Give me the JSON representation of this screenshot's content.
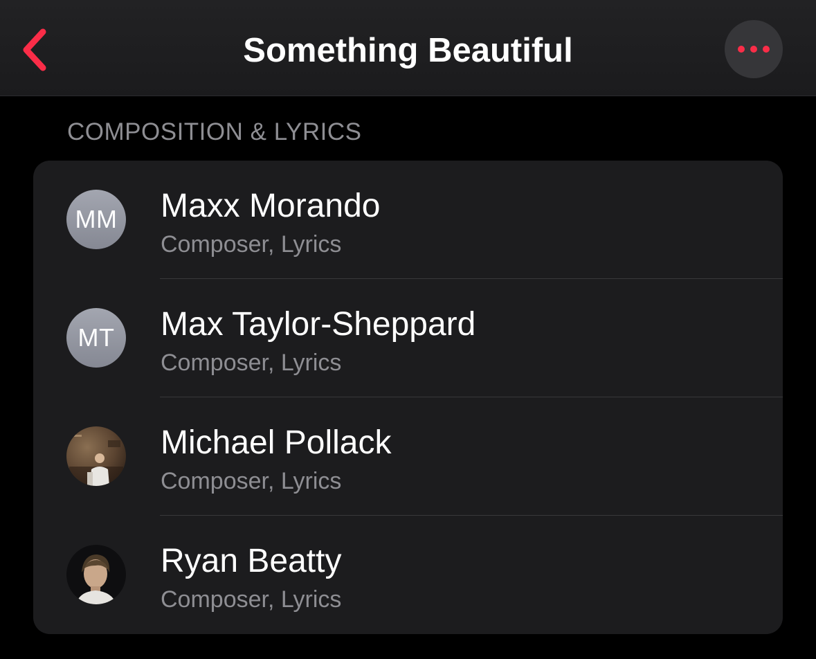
{
  "nav": {
    "title": "Something Beautiful",
    "back_icon": "chevron-left-icon",
    "more_icon": "ellipsis-icon",
    "accent_color": "#fa2d48"
  },
  "section": {
    "header": "COMPOSITION & LYRICS"
  },
  "credits": [
    {
      "name": "Maxx Morando",
      "role": "Composer, Lyrics",
      "avatar": {
        "type": "initials",
        "initials": "MM"
      }
    },
    {
      "name": "Max Taylor-Sheppard",
      "role": "Composer, Lyrics",
      "avatar": {
        "type": "initials",
        "initials": "MT"
      }
    },
    {
      "name": "Michael Pollack",
      "role": "Composer, Lyrics",
      "avatar": {
        "type": "photo"
      }
    },
    {
      "name": "Ryan Beatty",
      "role": "Composer, Lyrics",
      "avatar": {
        "type": "photo"
      }
    }
  ]
}
